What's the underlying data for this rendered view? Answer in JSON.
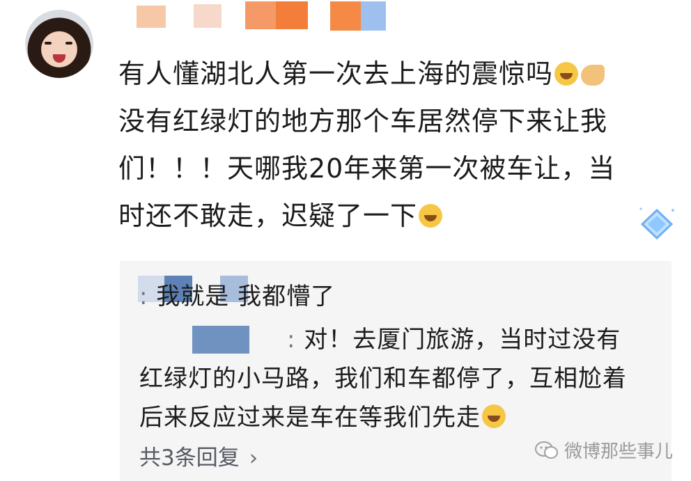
{
  "post": {
    "line1": "有人懂湖北人第一次去上海的震惊吗",
    "line2": "没有红绿灯的地方那个车居然停下来让我",
    "line3": "们！！！天哪我20年来第一次被车让，当",
    "line4": "时还不敢走，迟疑了一下",
    "emoji_names": [
      "laughing-crying-emoji",
      "clapping-hand-emoji"
    ]
  },
  "replies": {
    "reply1": "我就是 我都懵了",
    "reply2_line1": "对！去厦门旅游，当时过没有",
    "reply2_line2": "红绿灯的小马路，我们和车都停了，互相尬着",
    "reply2_line3": "后来反应过来是车在等我们先走",
    "more": "共3条回复",
    "more_icon": "chevron-right-icon"
  },
  "watermark": {
    "text": "微博那些事儿",
    "icon": "wechat-icon"
  },
  "colors": {
    "reply_bg": "#f5f5f6",
    "blur_orange": "#f39a5a",
    "blur_blue": "#8fb1e6"
  }
}
